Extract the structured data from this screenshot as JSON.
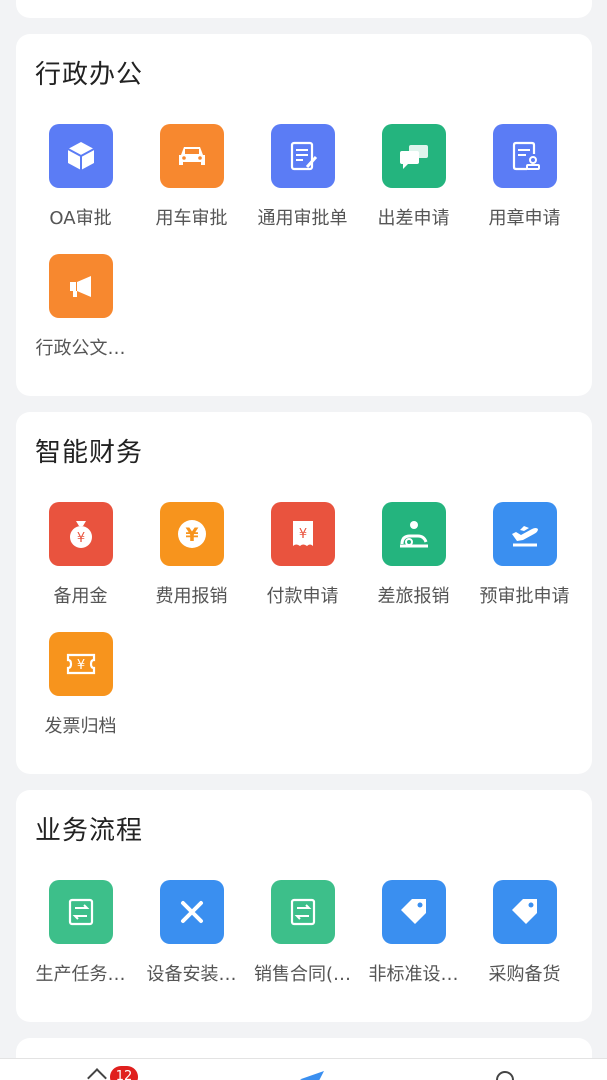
{
  "sections": [
    {
      "title": "行政办公",
      "items": [
        {
          "label": "OA审批",
          "color": "#5b7cf5",
          "icon": "box-icon"
        },
        {
          "label": "用车审批",
          "color": "#f7882f",
          "icon": "car-icon"
        },
        {
          "label": "通用审批单",
          "color": "#5b7cf5",
          "icon": "edit-document-icon"
        },
        {
          "label": "出差申请",
          "color": "#24b47e",
          "icon": "chat-icon"
        },
        {
          "label": "用章申请",
          "color": "#5b7cf5",
          "icon": "stamp-document-icon"
        },
        {
          "label": "行政公文…",
          "color": "#f7882f",
          "icon": "megaphone-icon"
        }
      ]
    },
    {
      "title": "智能财务",
      "items": [
        {
          "label": "备用金",
          "color": "#e9533e",
          "icon": "money-bag-icon"
        },
        {
          "label": "费用报销",
          "color": "#f7941d",
          "icon": "yen-coin-icon"
        },
        {
          "label": "付款申请",
          "color": "#e9533e",
          "icon": "invoice-yen-icon"
        },
        {
          "label": "差旅报销",
          "color": "#24b47e",
          "icon": "travel-icon"
        },
        {
          "label": "预审批申请",
          "color": "#3a8ff0",
          "icon": "airplane-icon"
        },
        {
          "label": "发票归档",
          "color": "#f7941d",
          "icon": "ticket-yen-icon"
        }
      ]
    },
    {
      "title": "业务流程",
      "items": [
        {
          "label": "生产任务…",
          "color": "#3dbf8a",
          "icon": "flow-document-icon"
        },
        {
          "label": "设备安装…",
          "color": "#3a8ff0",
          "icon": "tools-icon"
        },
        {
          "label": "销售合同(…",
          "color": "#3dbf8a",
          "icon": "flow-document-icon"
        },
        {
          "label": "非标准设…",
          "color": "#3a8ff0",
          "icon": "tag-icon"
        },
        {
          "label": "采购备货",
          "color": "#3a8ff0",
          "icon": "tag-icon"
        }
      ]
    }
  ],
  "tabbar": {
    "badge": "12"
  }
}
